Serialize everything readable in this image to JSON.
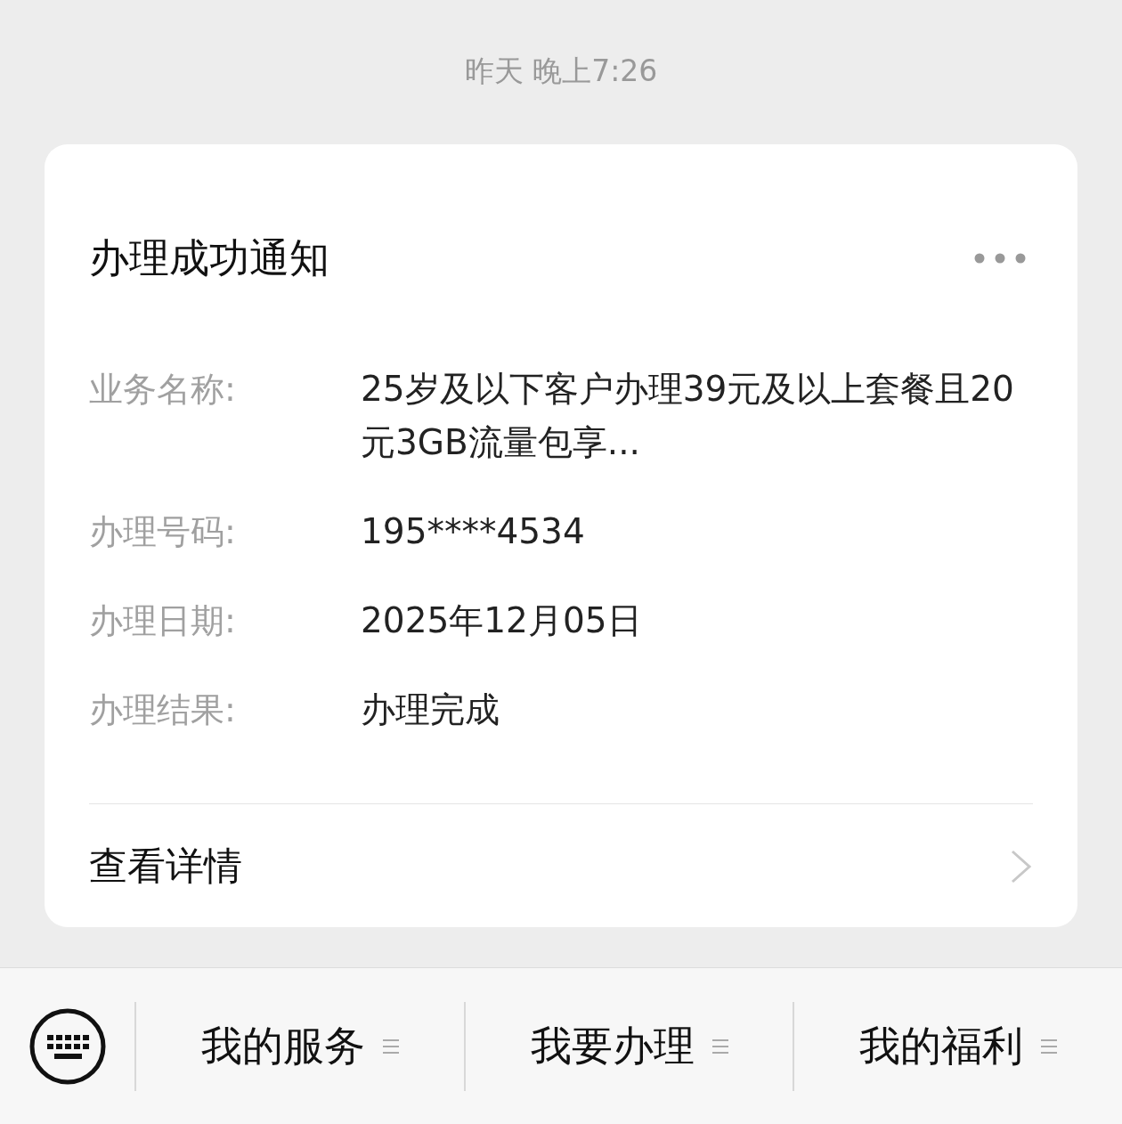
{
  "timestamp": "昨天 晚上7:26",
  "card": {
    "title": "办理成功通知",
    "fields": [
      {
        "label": "业务名称:",
        "value": "25岁及以下客户办理39元及以上套餐且20元3GB流量包享..."
      },
      {
        "label": "办理号码:",
        "value": "195****4534"
      },
      {
        "label": "办理日期:",
        "value": "2025年12月05日"
      },
      {
        "label": "办理结果:",
        "value": "办理完成"
      }
    ],
    "link": "查看详情"
  },
  "bottom_bar": {
    "menus": [
      {
        "label": "我的服务"
      },
      {
        "label": "我要办理"
      },
      {
        "label": "我的福利"
      }
    ]
  }
}
